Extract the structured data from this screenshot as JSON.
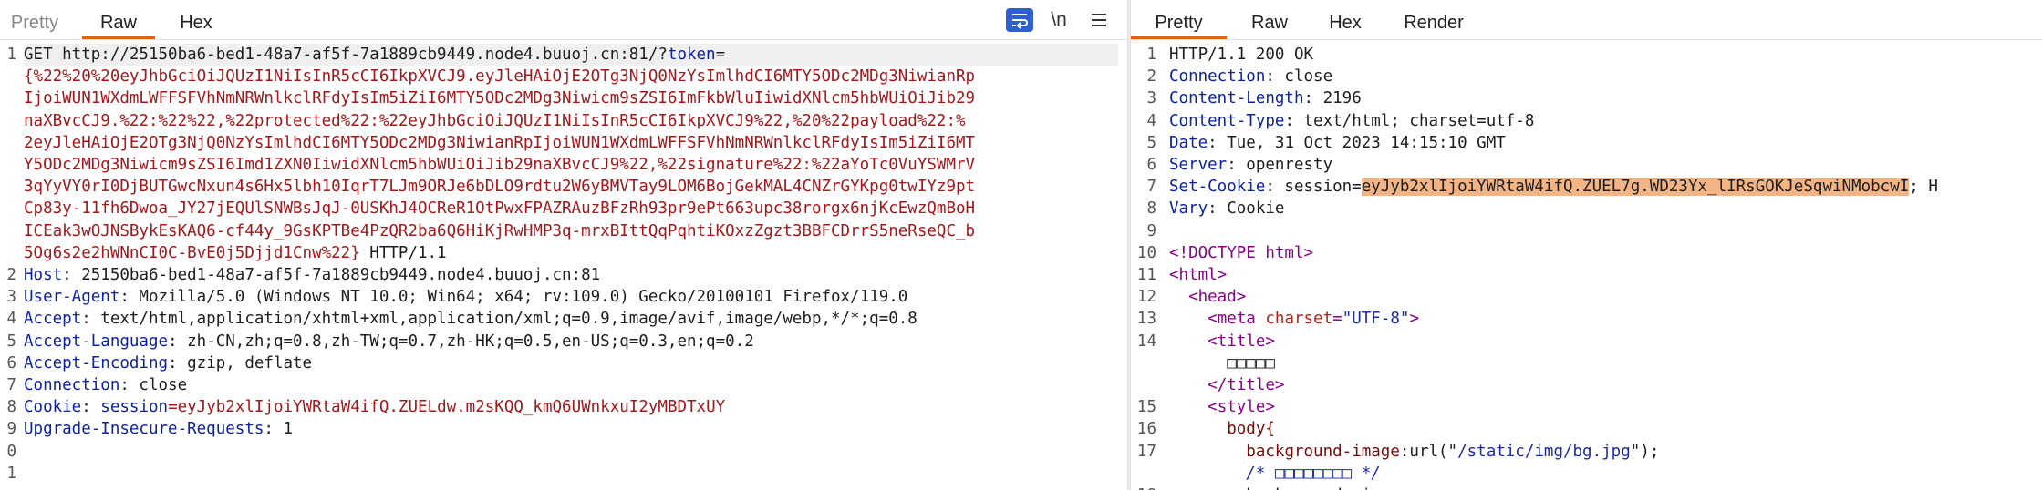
{
  "request": {
    "tabs": [
      {
        "label": "Pretty",
        "state": "inactive"
      },
      {
        "label": "Raw",
        "state": "active"
      },
      {
        "label": "Hex",
        "state": "inactive"
      }
    ],
    "tools": {
      "wrap_icon": "word-wrap-icon",
      "newline_label": "\\n",
      "menu_icon": "hamburger-menu-icon"
    },
    "lines": [
      {
        "n": "1",
        "parts": [
          {
            "t": "GET http://25150ba6-bed1-48a7-af5f-7a1889cb9449.node4.buuoj.cn:81/?"
          },
          {
            "t": "token",
            "c": "hdr"
          },
          {
            "t": "="
          }
        ]
      },
      {
        "n": "",
        "parts": [
          {
            "t": "{%22%20%20eyJhbGciOiJQUzI1NiIsInR5cCI6IkpXVCJ9.eyJleHAiOjE2OTg3NjQ0NzYsImlhdCI6MTY5ODc2MDg3NiwianRp",
            "c": "str"
          }
        ]
      },
      {
        "n": "",
        "parts": [
          {
            "t": "IjoiWUN1WXdmLWFFSFVhNmNRWnlkclRFdyIsIm5iZiI6MTY5ODc2MDg3Niwicm9sZSI6ImFkbWluIiwidXNlcm5hbWUiOiJib29",
            "c": "str"
          }
        ]
      },
      {
        "n": "",
        "parts": [
          {
            "t": "naXBvcCJ9.%22:%22%22,%22protected%22:%22eyJhbGciOiJQUzI1NiIsInR5cCI6IkpXVCJ9%22,%20%22payload%22:%",
            "c": "str"
          }
        ]
      },
      {
        "n": "",
        "parts": [
          {
            "t": "2eyJleHAiOjE2OTg3NjQ0NzYsImlhdCI6MTY5ODc2MDg3NiwianRpIjoiWUN1WXdmLWFFSFVhNmNRWnlkclRFdyIsIm5iZiI6MT",
            "c": "str"
          }
        ]
      },
      {
        "n": "",
        "parts": [
          {
            "t": "Y5ODc2MDg3Niwicm9sZSI6Imd1ZXN0IiwidXNlcm5hbWUiOiJib29naXBvcCJ9%22,%22signature%22:%22aYoTc0VuYSWMrV",
            "c": "str"
          }
        ]
      },
      {
        "n": "",
        "parts": [
          {
            "t": "3qYyVY0rI0DjBUTGwcNxun4s6Hx5lbh10IqrT7LJm9ORJe6bDLO9rdtu2W6yBMVTay9LOM6BojGekMAL4CNZrGYKpg0twIYz9pt",
            "c": "str"
          }
        ]
      },
      {
        "n": "",
        "parts": [
          {
            "t": "Cp83y-11fh6Dwoa_JY27jEQUlSNWBsJqJ-0USKhJ4OCReR1OtPwxFPAZRAuzBFzRh93pr9ePt663upc38rorgx6njKcEwzQmBoH",
            "c": "str"
          }
        ]
      },
      {
        "n": "",
        "parts": [
          {
            "t": "ICEak3wOJNSBykEsKAQ6-cf44y_9GsKPTBe4PzQR2ba6Q6HiKjRwHMP3q-mrxBIttQqPqhtiKOxzZgzt3BBFCDrrS5neRseQC_b",
            "c": "str"
          }
        ]
      },
      {
        "n": "",
        "parts": [
          {
            "t": "5Og6s2e2hWNnCI0C-BvE0j5Djjd1Cnw%22}",
            "c": "str"
          },
          {
            "t": " HTTP/1.1"
          }
        ]
      },
      {
        "n": "2",
        "parts": [
          {
            "t": "Host",
            "c": "hdr"
          },
          {
            "t": ": 25150ba6-bed1-48a7-af5f-7a1889cb9449.node4.buuoj.cn:81"
          }
        ]
      },
      {
        "n": "3",
        "parts": [
          {
            "t": "User-Agent",
            "c": "hdr"
          },
          {
            "t": ": Mozilla/5.0 (Windows NT 10.0; Win64; x64; rv:109.0) Gecko/20100101 Firefox/119.0"
          }
        ]
      },
      {
        "n": "4",
        "parts": [
          {
            "t": "Accept",
            "c": "hdr"
          },
          {
            "t": ": text/html,application/xhtml+xml,application/xml;q=0.9,image/avif,image/webp,*/*;q=0.8"
          }
        ]
      },
      {
        "n": "5",
        "parts": [
          {
            "t": "Accept-Language",
            "c": "hdr"
          },
          {
            "t": ": zh-CN,zh;q=0.8,zh-TW;q=0.7,zh-HK;q=0.5,en-US;q=0.3,en;q=0.2"
          }
        ]
      },
      {
        "n": "6",
        "parts": [
          {
            "t": "Accept-Encoding",
            "c": "hdr"
          },
          {
            "t": ": gzip, deflate"
          }
        ]
      },
      {
        "n": "7",
        "parts": [
          {
            "t": "Connection",
            "c": "hdr"
          },
          {
            "t": ": close"
          }
        ]
      },
      {
        "n": "8",
        "parts": [
          {
            "t": "Cookie",
            "c": "hdr"
          },
          {
            "t": ": "
          },
          {
            "t": "session",
            "c": "hdr"
          },
          {
            "t": "=",
            "c": "str"
          },
          {
            "t": "eyJyb2xlIjoiYWRtaW4ifQ.ZUELdw.m2sKQQ_kmQ6UWnkxuI2yMBDTxUY",
            "c": "str"
          }
        ]
      },
      {
        "n": "9",
        "parts": [
          {
            "t": "Upgrade-Insecure-Requests",
            "c": "hdr"
          },
          {
            "t": ": 1"
          }
        ]
      },
      {
        "n": "0",
        "parts": []
      },
      {
        "n": "1",
        "parts": []
      }
    ]
  },
  "response": {
    "tabs": [
      {
        "label": "Pretty",
        "state": "active"
      },
      {
        "label": "Raw",
        "state": "inactive"
      },
      {
        "label": "Hex",
        "state": "inactive"
      },
      {
        "label": "Render",
        "state": "inactive"
      }
    ],
    "lines": [
      {
        "n": "1",
        "parts": [
          {
            "t": "HTTP/1.1 200 OK"
          }
        ]
      },
      {
        "n": "2",
        "parts": [
          {
            "t": "Connection",
            "c": "hdr"
          },
          {
            "t": ": close"
          }
        ]
      },
      {
        "n": "3",
        "parts": [
          {
            "t": "Content-Length",
            "c": "hdr"
          },
          {
            "t": ": 2196"
          }
        ]
      },
      {
        "n": "4",
        "parts": [
          {
            "t": "Content-Type",
            "c": "hdr"
          },
          {
            "t": ": text/html; charset=utf-8"
          }
        ]
      },
      {
        "n": "5",
        "parts": [
          {
            "t": "Date",
            "c": "hdr"
          },
          {
            "t": ": Tue, 31 Oct 2023 14:15:10 GMT"
          }
        ]
      },
      {
        "n": "6",
        "parts": [
          {
            "t": "Server",
            "c": "hdr"
          },
          {
            "t": ": openresty"
          }
        ]
      },
      {
        "n": "7",
        "parts": [
          {
            "t": "Set-Cookie",
            "c": "hdr"
          },
          {
            "t": ": session="
          },
          {
            "t": "eyJyb2xlIjoiYWRtaW4ifQ.ZUEL7g.WD23Yx_lIRsGOKJeSqwiNMobcwI",
            "c": "sel"
          },
          {
            "t": "; H"
          }
        ]
      },
      {
        "n": "8",
        "parts": [
          {
            "t": "Vary",
            "c": "hdr"
          },
          {
            "t": ": Cookie"
          }
        ]
      },
      {
        "n": "9",
        "parts": []
      },
      {
        "n": "10",
        "parts": [
          {
            "t": "<!DOCTYPE html>",
            "c": "tag"
          }
        ]
      },
      {
        "n": "11",
        "parts": [
          {
            "t": "<html>",
            "c": "tag"
          }
        ]
      },
      {
        "n": "12",
        "parts": [
          {
            "t": "  "
          },
          {
            "t": "<head>",
            "c": "tag"
          }
        ]
      },
      {
        "n": "13",
        "parts": [
          {
            "t": "    "
          },
          {
            "t": "<meta ",
            "c": "tag"
          },
          {
            "t": "charset",
            "c": "attr"
          },
          {
            "t": "=",
            "c": "tag"
          },
          {
            "t": "\"UTF-8\"",
            "c": "val"
          },
          {
            "t": ">",
            "c": "tag"
          }
        ]
      },
      {
        "n": "14",
        "parts": [
          {
            "t": "    "
          },
          {
            "t": "<title>",
            "c": "tag"
          }
        ]
      },
      {
        "n": "",
        "parts": [
          {
            "t": "      □□□□□"
          }
        ]
      },
      {
        "n": "",
        "parts": [
          {
            "t": "    "
          },
          {
            "t": "</title>",
            "c": "tag"
          }
        ]
      },
      {
        "n": "15",
        "parts": [
          {
            "t": "    "
          },
          {
            "t": "<style>",
            "c": "tag"
          }
        ]
      },
      {
        "n": "16",
        "parts": [
          {
            "t": "      "
          },
          {
            "t": "body{",
            "c": "prop"
          }
        ]
      },
      {
        "n": "17",
        "parts": [
          {
            "t": "        "
          },
          {
            "t": "background-image",
            "c": "prop"
          },
          {
            "t": ":url(\""
          },
          {
            "t": "/static/img/bg.jpg",
            "c": "val"
          },
          {
            "t": "\");"
          }
        ]
      },
      {
        "n": "",
        "parts": [
          {
            "t": "        "
          },
          {
            "t": "/* □□□□□□□□ */",
            "c": "cmt"
          }
        ]
      },
      {
        "n": "18",
        "parts": [
          {
            "t": "        background-size: cover;"
          }
        ]
      }
    ]
  }
}
